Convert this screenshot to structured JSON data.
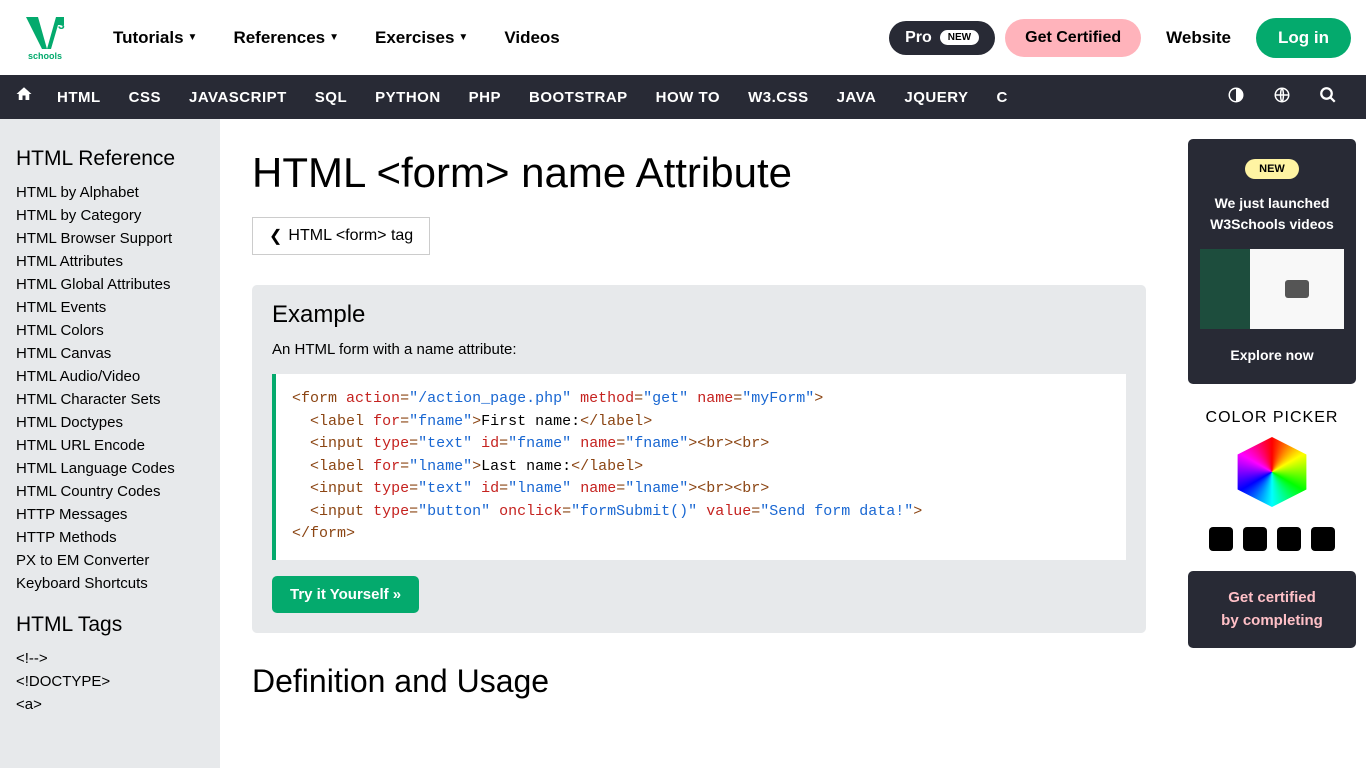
{
  "topnav": {
    "items": [
      "Tutorials",
      "References",
      "Exercises",
      "Videos"
    ],
    "pro": "Pro",
    "pro_badge": "NEW",
    "cert": "Get Certified",
    "website": "Website",
    "login": "Log in"
  },
  "logo_text": "schools",
  "secondnav": {
    "items": [
      "HTML",
      "CSS",
      "JAVASCRIPT",
      "SQL",
      "PYTHON",
      "PHP",
      "BOOTSTRAP",
      "HOW TO",
      "W3.CSS",
      "JAVA",
      "JQUERY",
      "C"
    ]
  },
  "sidebar": {
    "heading1": "HTML Reference",
    "refs": [
      "HTML by Alphabet",
      "HTML by Category",
      "HTML Browser Support",
      "HTML Attributes",
      "HTML Global Attributes",
      "HTML Events",
      "HTML Colors",
      "HTML Canvas",
      "HTML Audio/Video",
      "HTML Character Sets",
      "HTML Doctypes",
      "HTML URL Encode",
      "HTML Language Codes",
      "HTML Country Codes",
      "HTTP Messages",
      "HTTP Methods",
      "PX to EM Converter",
      "Keyboard Shortcuts"
    ],
    "heading2": "HTML Tags",
    "tags": [
      "<!-->",
      "<!DOCTYPE>",
      "<a>"
    ]
  },
  "main": {
    "title": "HTML <form> name Attribute",
    "back": "HTML <form> tag",
    "example_heading": "Example",
    "example_desc": "An HTML form with a name attribute:",
    "try_btn": "Try it Yourself »",
    "def_heading": "Definition and Usage"
  },
  "rightbar": {
    "new_badge": "NEW",
    "promo_line1": "We just launched",
    "promo_line2": "W3Schools videos",
    "explore": "Explore now",
    "colorpicker": "COLOR PICKER",
    "cert_line1": "Get certified",
    "cert_line2": "by completing"
  }
}
